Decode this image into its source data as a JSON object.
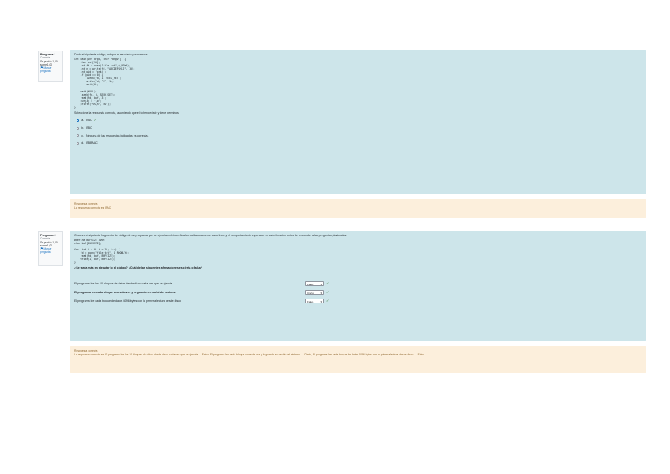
{
  "q1": {
    "info": {
      "number": "Pregunta 1",
      "state": "Correcta",
      "mark": "Se puntúa 1,00 sobre 1,00",
      "flag": "Marcar pregunta",
      "flag_icon": "flag-icon"
    },
    "intro": "Dado el siguiente código, indique el resultado por consola:",
    "code": [
      "int main(int argc, char *argv[]) {",
      "    char buf[10];",
      "    int fd = open(\"file.txt\",O_RDWR);",
      "    int n = write(fd, \"ABCDEFGHIJ\", 10);",
      "    int pid = fork();",
      "    if (pid == 0) {",
      "        lseek(fd, 1, SEEK_SET);",
      "        write(fd, \"X\", 1);",
      "        exit(0);",
      "    }",
      "    wait(NULL);",
      "    lseek(fd, 0, SEEK_SET);",
      "    read(fd, buf, 3);",
      "    buf[3] = '\\0';",
      "    printf(\"%s\\n\", buf);",
      "}"
    ],
    "prompt": "Seleccione la respuesta correcta, asumiendo que el fichero existe y tiene permisos:",
    "options": [
      {
        "letter": "a.",
        "text": "BAC",
        "selected": true,
        "correct": true
      },
      {
        "letter": "b.",
        "text": "BBC",
        "selected": false,
        "correct": false
      },
      {
        "letter": "c.",
        "text": "Ninguna de las respuestas indicadas es correcta.",
        "selected": false,
        "correct": false
      },
      {
        "letter": "d.",
        "text": "BBBAAC",
        "selected": false,
        "correct": false
      }
    ],
    "feedback_1": "Respuesta correcta",
    "feedback_2": "La respuesta correcta es: BAC"
  },
  "q2": {
    "info": {
      "number": "Pregunta 2",
      "state": "Correcta",
      "mark": "Se puntúa 1,00 sobre 1,00",
      "flag": "Marcar pregunta",
      "flag_icon": "flag-icon"
    },
    "intro": "Observe el siguiente fragmento de código de un programa que se ejecuta en Linux. Analice cuidadosamente cada línea y el comportamiento esperado en cada iteración antes de responder a las preguntas planteadas:",
    "code": [
      "#define BUFSIZE 4096",
      "char buf[BUFSIZE];",
      "",
      "for (int i = 0; i < 10; i++) {",
      "    fd = open(\"file.txt\", O_RDONLY);",
      "    read(fd, buf, BUFSIZE);",
      "    write(1, buf, BUFSIZE);",
      "}"
    ],
    "prompt": "¿Se tarda más en ejecutar lo el código? ¿Cuál de las siguientes afirmaciones es cierta o falsa?",
    "rows": [
      {
        "statement": "El programa lee los 10 bloques de datos desde disco cada vez que se ejecuta",
        "value": "Falso",
        "correct": true
      },
      {
        "statement": "El programa lee cada bloque una sola vez y lo guarda en caché del sistema",
        "value": "Cierto",
        "correct": true
      },
      {
        "statement": "El programa lee cada bloque de datos 4096 bytes con la primera lectura desde disco",
        "value": "Falso",
        "correct": true
      }
    ],
    "feedback_1": "Respuesta correcta",
    "feedback_2": "La respuesta correcta es: El programa lee los 10 bloques de datos desde disco cada vez que se ejecuta → Falso, El programa lee cada bloque una sola vez y lo guarda en caché del sistema → Cierto, El programa lee cada bloque de datos 4096 bytes con la primera lectura desde disco → Falso"
  },
  "colors": {
    "formulation_bg": "#cde5ea",
    "feedback_bg": "#fcefdc",
    "correct": "#357a32",
    "link": "#0f6cbf"
  }
}
